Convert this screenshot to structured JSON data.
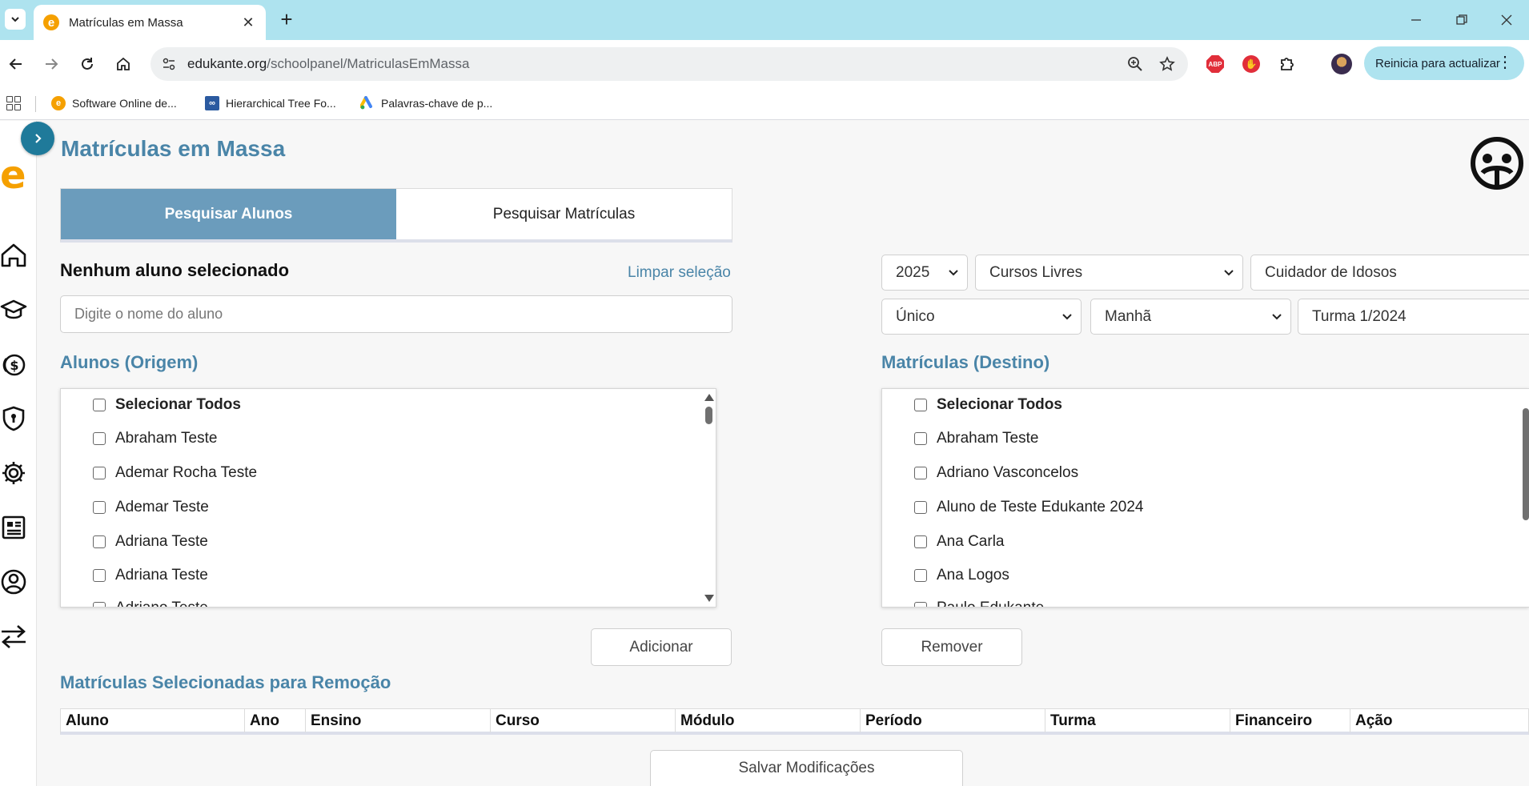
{
  "browser": {
    "tab_title": "Matrículas em Massa",
    "url_host": "edukante.org",
    "url_path": "/schoolpanel/MatriculasEmMassa",
    "update_label": "Reinicia para actualizar",
    "bookmarks": [
      {
        "label": "Software Online de...",
        "icon": "edukante-logo-icon"
      },
      {
        "label": "Hierarchical Tree Fo...",
        "icon": "codepen-icon"
      },
      {
        "label": "Palavras-chave de p...",
        "icon": "google-ads-icon"
      }
    ],
    "extensions": [
      "adblock-plus-icon",
      "stop-extension-icon",
      "puzzle-icon"
    ]
  },
  "colors": {
    "brand_orange": "#f5a000",
    "accent_blue": "#4a85a8",
    "tab_active": "#6b9cbc",
    "chrome_cyan": "#aee3ef"
  },
  "sidebar": {
    "logo": "e",
    "items": [
      "home-icon",
      "graduation-cap-icon",
      "coins-icon",
      "shield-icon",
      "gear-icon",
      "document-icon",
      "user-circle-icon",
      "transfer-arrows-icon"
    ]
  },
  "page": {
    "title": "Matrículas em Massa",
    "tabs": [
      {
        "label": "Pesquisar Alunos",
        "active": true
      },
      {
        "label": "Pesquisar Matrículas",
        "active": false
      }
    ],
    "selection_status": "Nenhum aluno selecionado",
    "clear_selection": "Limpar seleção",
    "search_placeholder": "Digite o nome do aluno",
    "source": {
      "title": "Alunos (Origem)",
      "select_all": "Selecionar Todos",
      "items": [
        "Abraham Teste",
        "Ademar Rocha Teste",
        "Ademar Teste",
        "Adriana Teste",
        "Adriana Teste",
        "Adriano Teste"
      ]
    },
    "destination": {
      "title": "Matrículas (Destino)",
      "select_all": "Selecionar Todos",
      "items": [
        "Abraham Teste",
        "Adriano Vasconcelos",
        "Aluno de Teste Edukante 2024",
        "Ana Carla",
        "Ana Logos",
        "Paulo Edukante"
      ]
    },
    "filters": {
      "year": "2025",
      "teaching": "Cursos Livres",
      "course": "Cuidador de Idosos",
      "module": "Único",
      "period": "Manhã",
      "class": "Turma 1/2024"
    },
    "add_button": "Adicionar",
    "remove_button": "Remover",
    "removal_title": "Matrículas Selecionadas para Remoção",
    "table_columns": [
      "Aluno",
      "Ano",
      "Ensino",
      "Curso",
      "Módulo",
      "Período",
      "Turma",
      "Financeiro",
      "Ação"
    ],
    "save_button": "Salvar Modificações"
  }
}
